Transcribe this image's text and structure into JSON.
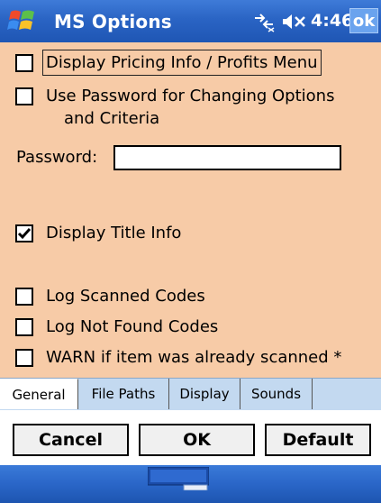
{
  "titlebar": {
    "title": "MS Options",
    "time": "4:46",
    "ok_label": "ok",
    "icons": [
      "windows-start-icon",
      "connectivity-icon",
      "volume-muted-icon"
    ]
  },
  "options": {
    "display_pricing": {
      "label": "Display Pricing Info / Profits Menu",
      "checked": false
    },
    "use_password": {
      "label_line1": "Use Password for Changing Options",
      "label_line2": "and Criteria",
      "checked": false
    },
    "password_label": "Password:",
    "password_value": "",
    "display_title": {
      "label": "Display Title Info",
      "checked": true
    },
    "log_scanned": {
      "label": "Log Scanned Codes",
      "checked": false
    },
    "log_not_found": {
      "label": "Log Not Found Codes",
      "checked": false
    },
    "warn_scanned": {
      "label": "WARN if item was already scanned *",
      "checked": false
    }
  },
  "tabs": [
    {
      "label": "General",
      "active": true
    },
    {
      "label": "File Paths",
      "active": false
    },
    {
      "label": "Display",
      "active": false
    },
    {
      "label": "Sounds",
      "active": false
    }
  ],
  "buttons": {
    "cancel": "Cancel",
    "ok": "OK",
    "default": "Default"
  },
  "colors": {
    "background": "#f7cba7",
    "titlebar": "#2a64c4",
    "tabbar": "#c3d9f0"
  }
}
